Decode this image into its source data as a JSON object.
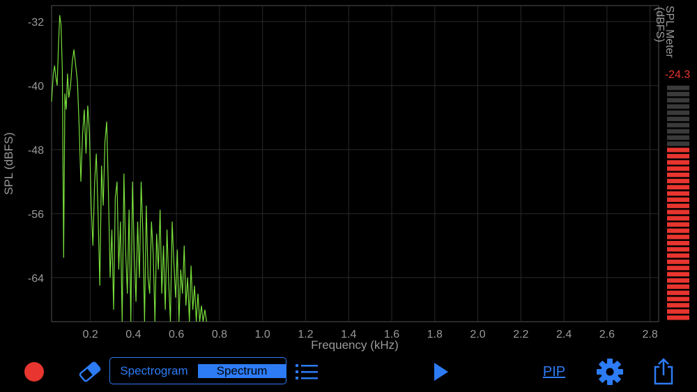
{
  "chart_data": {
    "type": "line",
    "xlabel": "Frequency (kHz)",
    "ylabel": "SPL (dBFS)",
    "xlim": [
      0.02,
      2.84
    ],
    "ylim": [
      -69.5,
      -30
    ],
    "x_ticks": [
      0.2,
      0.4,
      0.6,
      0.8,
      1.0,
      1.2,
      1.4,
      1.6,
      1.8,
      2.0,
      2.2,
      2.4,
      2.6,
      2.8
    ],
    "x_tick_labels": [
      "0.2",
      "0.4",
      "0.6",
      "0.8",
      "1.0",
      "1.2",
      "1.4",
      "1.6",
      "1.8",
      "2.0",
      "2.2",
      "2.4",
      "2.6",
      "2.8"
    ],
    "y_ticks": [
      -32,
      -40,
      -48,
      -56,
      -64
    ],
    "y_tick_labels": [
      "-32",
      "-40",
      "-48",
      "-56",
      "-64"
    ],
    "grid": true,
    "series": [
      {
        "color": "#79e03c",
        "x": [
          0.02,
          0.028,
          0.034,
          0.04,
          0.046,
          0.052,
          0.058,
          0.064,
          0.07,
          0.076,
          0.082,
          0.088,
          0.094,
          0.1,
          0.108,
          0.116,
          0.124,
          0.132,
          0.14,
          0.148,
          0.156,
          0.164,
          0.172,
          0.18,
          0.188,
          0.196,
          0.204,
          0.212,
          0.22,
          0.228,
          0.236,
          0.244,
          0.252,
          0.26,
          0.268,
          0.276,
          0.284,
          0.292,
          0.3,
          0.308,
          0.316,
          0.324,
          0.332,
          0.34,
          0.348,
          0.356,
          0.364,
          0.372,
          0.38,
          0.388,
          0.396,
          0.404,
          0.412,
          0.42,
          0.428,
          0.436,
          0.444,
          0.452,
          0.46,
          0.468,
          0.476,
          0.484,
          0.492,
          0.5,
          0.508,
          0.516,
          0.524,
          0.532,
          0.54,
          0.548,
          0.556,
          0.564,
          0.572,
          0.58,
          0.588,
          0.596,
          0.604,
          0.612,
          0.62,
          0.628,
          0.636,
          0.644,
          0.652,
          0.66,
          0.668,
          0.676,
          0.684,
          0.692,
          0.7,
          0.708,
          0.716,
          0.724,
          0.732,
          0.74
        ],
        "y": [
          -42.0,
          -38.5,
          -37.5,
          -39.0,
          -40.0,
          -35.0,
          -31.2,
          -32.5,
          -38.0,
          -61.5,
          -41.0,
          -43.0,
          -38.5,
          -41.5,
          -40.0,
          -37.0,
          -35.5,
          -37.5,
          -39.5,
          -45.0,
          -52.0,
          -46.0,
          -43.0,
          -48.5,
          -42.5,
          -46.0,
          -55.0,
          -60.0,
          -52.0,
          -48.5,
          -56.0,
          -65.0,
          -50.0,
          -55.0,
          -47.0,
          -44.5,
          -53.0,
          -64.0,
          -58.0,
          -68.0,
          -54.0,
          -52.0,
          -63.0,
          -57.0,
          -69.5,
          -51.0,
          -60.5,
          -66.0,
          -55.5,
          -69.5,
          -52.0,
          -61.0,
          -67.0,
          -57.0,
          -64.0,
          -52.0,
          -58.5,
          -69.5,
          -55.0,
          -64.0,
          -66.0,
          -57.0,
          -61.0,
          -69.5,
          -58.5,
          -63.0,
          -55.5,
          -66.0,
          -60.0,
          -68.0,
          -58.0,
          -64.5,
          -69.5,
          -57.0,
          -62.0,
          -66.5,
          -60.5,
          -69.5,
          -63.0,
          -66.0,
          -60.0,
          -67.5,
          -64.0,
          -69.5,
          -62.5,
          -68.0,
          -65.0,
          -69.5,
          -66.0,
          -69.5,
          -67.5,
          -69.5,
          -68.0,
          -69.5
        ]
      }
    ]
  },
  "meter": {
    "title_line1": "SPL Meter",
    "title_line2": "(dBFS)",
    "value": "-24.3",
    "total_segments": 38,
    "lit_segments": 28,
    "lit_color": "#e8352f",
    "unlit_color": "#3a3a3a",
    "value_color": "#e8352f"
  },
  "toolbar": {
    "record_icon": "record-icon",
    "eraser_icon": "eraser-icon",
    "spectrogram_label": "Spectrogram",
    "spectrum_label": "Spectrum",
    "list_icon": "list-icon",
    "play_icon": "play-icon",
    "pip_label": "PIP",
    "gear_icon": "gear-icon",
    "share_icon": "share-icon",
    "accent_color": "#2d7cf6"
  }
}
